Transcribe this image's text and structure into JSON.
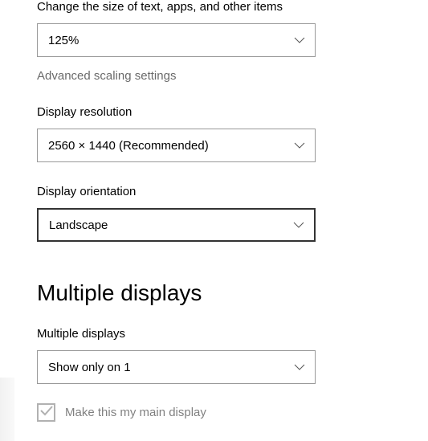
{
  "scale": {
    "label": "Change the size of text, apps, and other items",
    "value": "125%"
  },
  "advancedLink": "Advanced scaling settings",
  "resolution": {
    "label": "Display resolution",
    "value": "2560 × 1440 (Recommended)"
  },
  "orientation": {
    "label": "Display orientation",
    "value": "Landscape"
  },
  "multipleDisplays": {
    "header": "Multiple displays",
    "label": "Multiple displays",
    "value": "Show only on 1"
  },
  "mainDisplayCheckbox": {
    "label": "Make this my main display",
    "checked": true,
    "disabled": true
  }
}
